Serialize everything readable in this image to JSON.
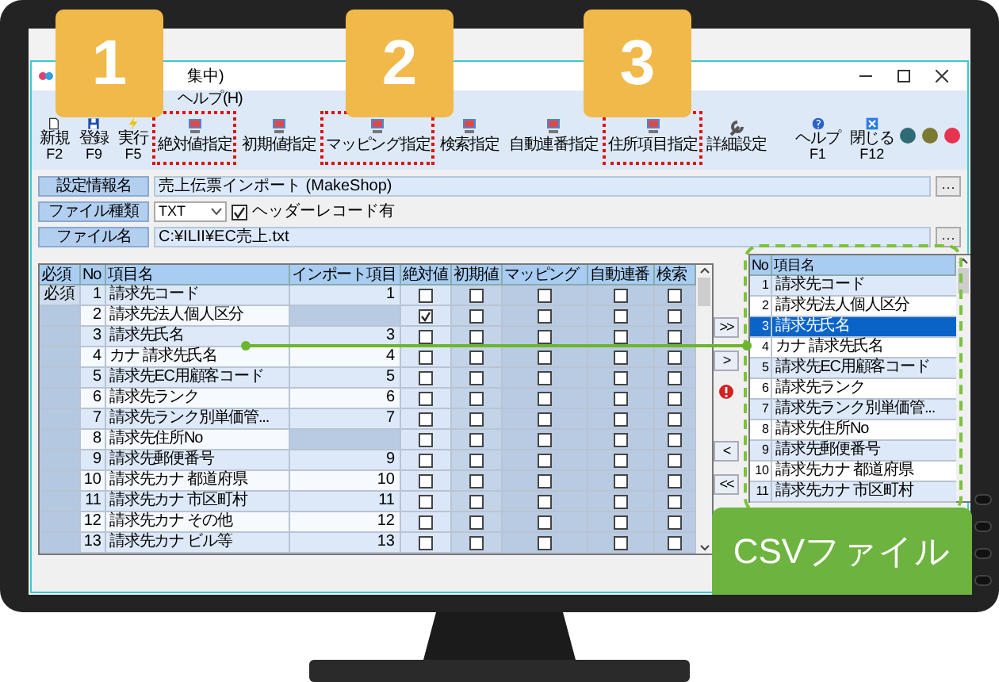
{
  "window": {
    "title": "集中)",
    "menu": [
      "ヘルプ(H)"
    ]
  },
  "toolbar": [
    {
      "kind": "new",
      "label": "新規",
      "key": "F2",
      "highlighted": false
    },
    {
      "kind": "save",
      "label": "登録",
      "key": "F9",
      "highlighted": false
    },
    {
      "kind": "run",
      "label": "実行",
      "key": "F5",
      "highlighted": false
    },
    {
      "kind": "spec",
      "label": "絶対値指定",
      "highlighted": true
    },
    {
      "kind": "spec",
      "label": "初期値指定",
      "highlighted": false
    },
    {
      "kind": "spec",
      "label": "マッピング指定",
      "highlighted": true
    },
    {
      "kind": "spec",
      "label": "検索指定",
      "highlighted": false
    },
    {
      "kind": "spec",
      "label": "自動連番指定",
      "highlighted": false
    },
    {
      "kind": "spec",
      "label": "住所項目指定",
      "highlighted": true
    },
    {
      "kind": "wrench",
      "label": "詳細設定",
      "highlighted": false
    }
  ],
  "toolbar_right": [
    {
      "kind": "help",
      "label": "ヘルプ",
      "key": "F1"
    },
    {
      "kind": "close",
      "label": "閉じる",
      "key": "F12"
    }
  ],
  "status_lights": [
    {
      "color": "#2f6b74"
    },
    {
      "color": "#7b7a32"
    },
    {
      "color": "#e6334f"
    }
  ],
  "settings": [
    {
      "kind": "text",
      "label": "設定情報名",
      "value": "売上伝票インポート (MakeShop)",
      "browse": "···"
    },
    {
      "kind": "select",
      "label": "ファイル種類",
      "value": "TXT",
      "checkbox": {
        "label": "ヘッダーレコード有",
        "checked": true
      }
    },
    {
      "kind": "text",
      "label": "ファイル名",
      "value": "C:¥ILII¥EC売上.txt",
      "browse": "···"
    }
  ],
  "mapping_table": {
    "columns": [
      "必須",
      "No",
      "項目名",
      "インポート項目",
      "絶対値",
      "初期値",
      "マッピング",
      "自動連番",
      "検索"
    ],
    "rows": [
      {
        "required": "必須",
        "no": "1",
        "name": "請求先コード",
        "import": "1",
        "checks": [
          false,
          false,
          false,
          false,
          false
        ]
      },
      {
        "no": "2",
        "name": "請求先法人個人区分",
        "checks": [
          true,
          false,
          false,
          false,
          false
        ]
      },
      {
        "no": "3",
        "name": "請求先氏名",
        "import": "3",
        "checks": [
          false,
          false,
          false,
          false,
          false
        ]
      },
      {
        "no": "4",
        "name": "カナ 請求先氏名",
        "import": "4",
        "checks": [
          false,
          false,
          false,
          false,
          false
        ]
      },
      {
        "no": "5",
        "name": "請求先EC用顧客コード",
        "import": "5",
        "checks": [
          false,
          false,
          false,
          false,
          false
        ]
      },
      {
        "no": "6",
        "name": "請求先ランク",
        "import": "6",
        "checks": [
          false,
          false,
          false,
          false,
          false
        ]
      },
      {
        "no": "7",
        "name": "請求先ランク別単価管...",
        "import": "7",
        "checks": [
          false,
          false,
          false,
          false,
          false
        ]
      },
      {
        "no": "8",
        "name": "請求先住所No",
        "checks": [
          false,
          false,
          false,
          false,
          false
        ]
      },
      {
        "no": "9",
        "name": "請求先郵便番号",
        "import": "9",
        "checks": [
          false,
          false,
          false,
          false,
          false
        ]
      },
      {
        "no": "10",
        "name": "請求先カナ 都道府県",
        "import": "10",
        "checks": [
          false,
          false,
          false,
          false,
          false
        ]
      },
      {
        "no": "11",
        "name": "請求先カナ 市区町村",
        "import": "11",
        "checks": [
          false,
          false,
          false,
          false,
          false
        ]
      },
      {
        "no": "12",
        "name": "請求先カナ その他",
        "import": "12",
        "checks": [
          false,
          false,
          false,
          false,
          false
        ]
      },
      {
        "no": "13",
        "name": "請求先カナ ビル等",
        "import": "13",
        "checks": [
          false,
          false,
          false,
          false,
          false
        ]
      }
    ]
  },
  "transfer_buttons": [
    ">>",
    ">",
    "<",
    "<<"
  ],
  "csv_list": {
    "columns": [
      "No",
      "項目名"
    ],
    "rows": [
      {
        "no": "1",
        "name": "請求先コード",
        "selected": false
      },
      {
        "no": "2",
        "name": "請求先法人個人区分",
        "selected": false
      },
      {
        "no": "3",
        "name": "請求先氏名",
        "selected": true
      },
      {
        "no": "4",
        "name": "カナ 請求先氏名",
        "selected": false
      },
      {
        "no": "5",
        "name": "請求先EC用顧客コード",
        "selected": false
      },
      {
        "no": "6",
        "name": "請求先ランク",
        "selected": false
      },
      {
        "no": "7",
        "name": "請求先ランク別単価管...",
        "selected": false
      },
      {
        "no": "8",
        "name": "請求先住所No",
        "selected": false
      },
      {
        "no": "9",
        "name": "請求先郵便番号",
        "selected": false
      },
      {
        "no": "10",
        "name": "請求先カナ 都道府県",
        "selected": false
      },
      {
        "no": "11",
        "name": "請求先カナ 市区町村",
        "selected": false
      }
    ]
  },
  "badges": [
    "1",
    "2",
    "3"
  ],
  "csv_label": "CSVファイル"
}
